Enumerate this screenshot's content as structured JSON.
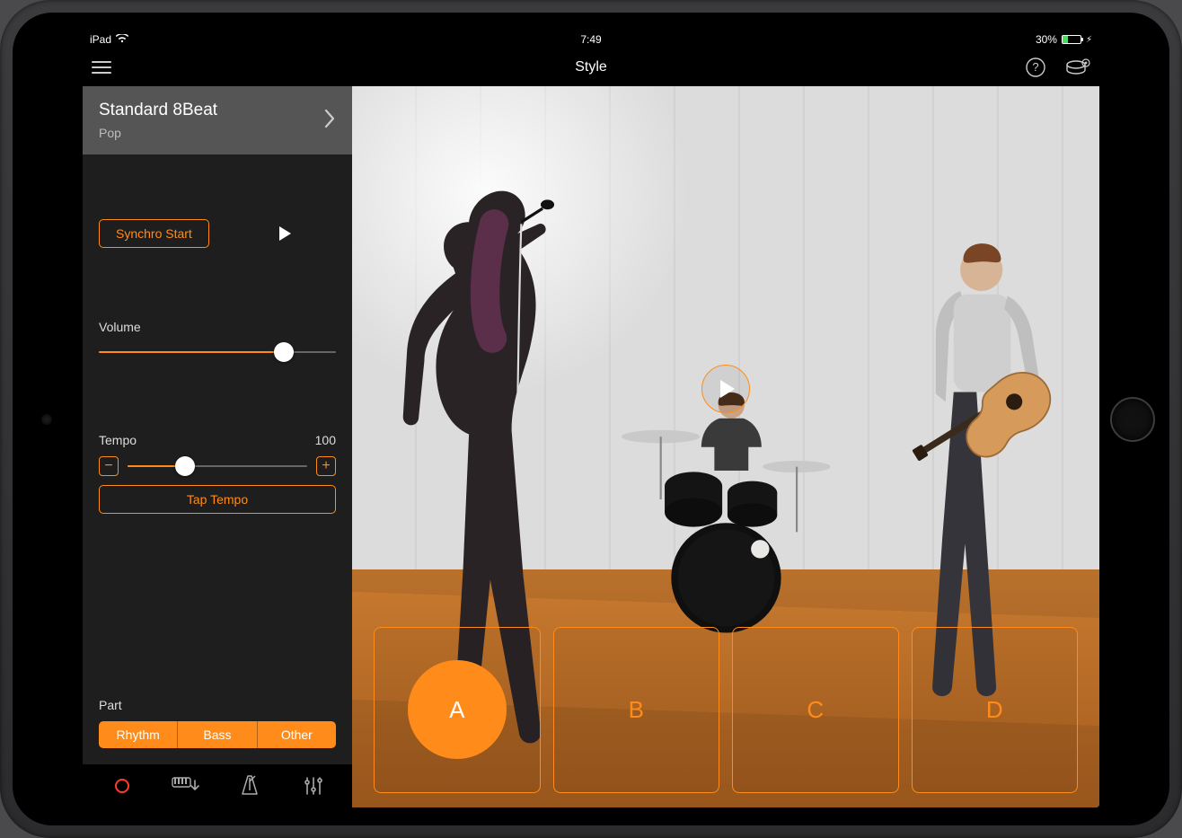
{
  "status": {
    "device": "iPad",
    "time": "7:49",
    "battery_pct": "30%"
  },
  "toolbar": {
    "title": "Style"
  },
  "style_picker": {
    "name": "Standard 8Beat",
    "genre": "Pop"
  },
  "controls": {
    "synchro_start": "Synchro Start",
    "volume_label": "Volume",
    "volume_value": 78,
    "tempo_label": "Tempo",
    "tempo_value": "100",
    "tempo_pct": 32,
    "tap_tempo": "Tap Tempo",
    "part_label": "Part",
    "parts": [
      "Rhythm",
      "Bass",
      "Other"
    ]
  },
  "sections": [
    "A",
    "B",
    "C",
    "D"
  ],
  "active_section": "A"
}
